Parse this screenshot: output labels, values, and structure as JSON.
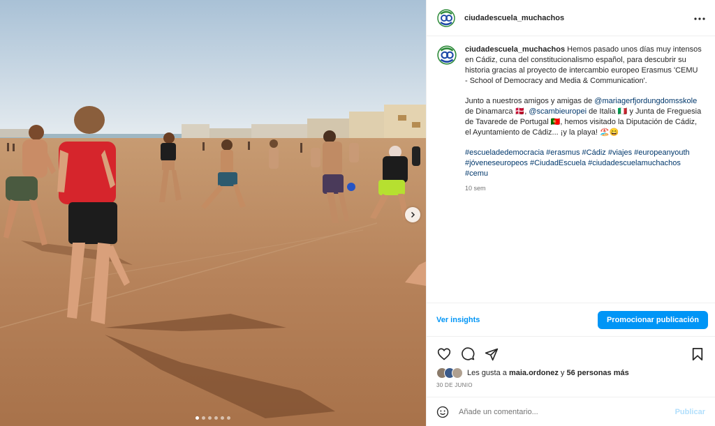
{
  "post": {
    "username": "ciudadescuela_muchachos",
    "caption": {
      "username": "ciudadescuela_muchachos",
      "p1": "Hemos pasado unos días muy intensos en Cádiz, cuna del constitucionalismo español, para descubrir su historia gracias al proyecto de intercambio europeo Erasmus 'CEMU - School of Democracy and Media & Communication'.",
      "p2_intro": "Junto a nuestros amigos y amigas de",
      "mention1": "@mariagerfjordungdomsskole",
      "p2_mid1": "de Dinamarca 🇩🇰,",
      "mention2": "@scambieuropei",
      "p2_mid2": "de Italia 🇮🇹 y Junta de Freguesia de Tavarede de Portugal 🇵🇹, hemos visitado la Diputación de Cádiz, el Ayuntamiento de Cádiz... ¡y la playa! 🏖️😄",
      "hashtags": "#escueladedemocracia #erasmus #Cádiz #viajes #europeanyouth #jóveneseuropeos #CiudadEscuela #ciudadescuelamuchachos #cemu"
    },
    "time_ago": "10 sem",
    "insights_label": "Ver insights",
    "promote_label": "Promocionar publicación",
    "likes": {
      "prefix": "Les gusta a",
      "user": "maia.ordonez",
      "middle": "y",
      "others": "56 personas más"
    },
    "date": "30 DE JUNIO",
    "comment_placeholder": "Añade un comentario...",
    "publish_label": "Publicar"
  },
  "carousel": {
    "slides": 6,
    "active_index": 0
  },
  "icons": [
    "heart-icon",
    "comment-icon",
    "share-icon",
    "bookmark-icon",
    "more-icon",
    "emoji-icon",
    "chevron-right-icon"
  ],
  "colors": {
    "accent": "#0095f6",
    "link": "#00376b",
    "muted": "#737373"
  }
}
